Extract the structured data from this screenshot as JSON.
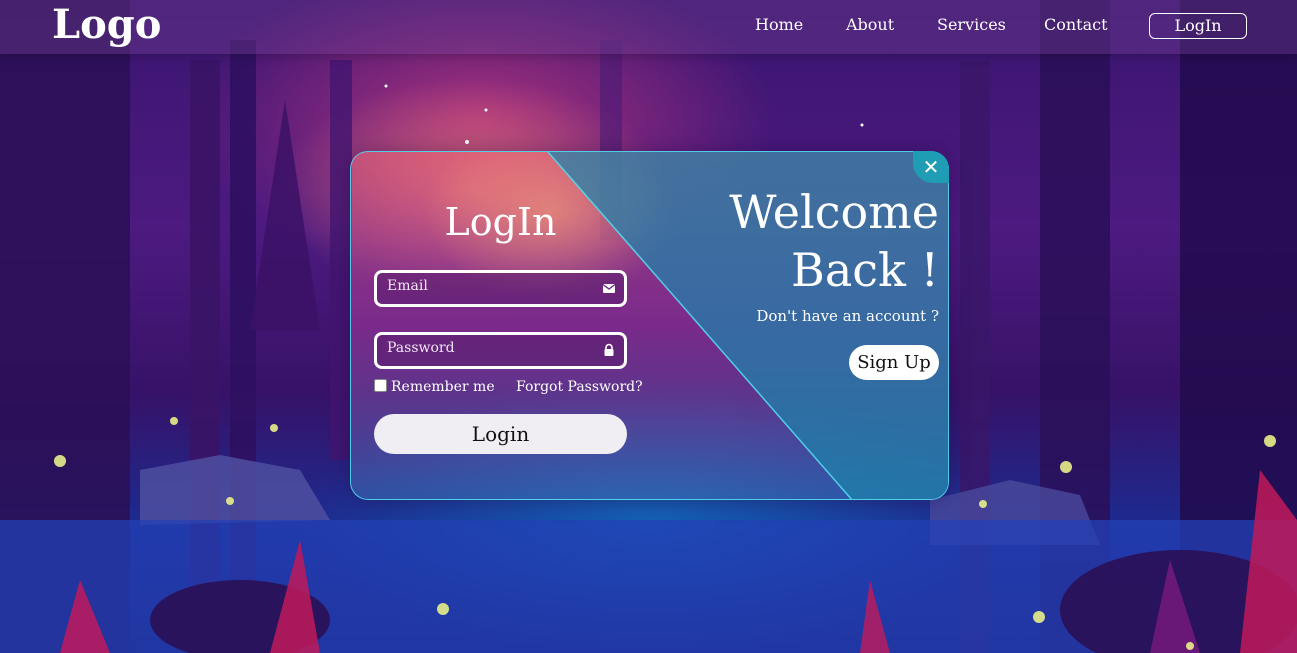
{
  "nav": {
    "logo": "Logo",
    "links": [
      "Home",
      "About",
      "Services",
      "Contact"
    ],
    "login_button": "LogIn"
  },
  "login_form": {
    "title": "LogIn",
    "email_placeholder": "Email",
    "password_placeholder": "Password",
    "remember_me": "Remember me",
    "forgot_password": "Forgot Password?",
    "submit_label": "Login",
    "close_icon": "close-icon"
  },
  "welcome_panel": {
    "heading_line1": "Welcome",
    "heading_line2": "Back !",
    "prompt": "Don't have an account ?",
    "signup_label": "Sign Up"
  },
  "icons": {
    "email": "envelope-icon",
    "password": "lock-icon",
    "close": "close-icon"
  },
  "colors": {
    "accent_teal": "#1e9db4",
    "card_border": "#50dcf0"
  }
}
